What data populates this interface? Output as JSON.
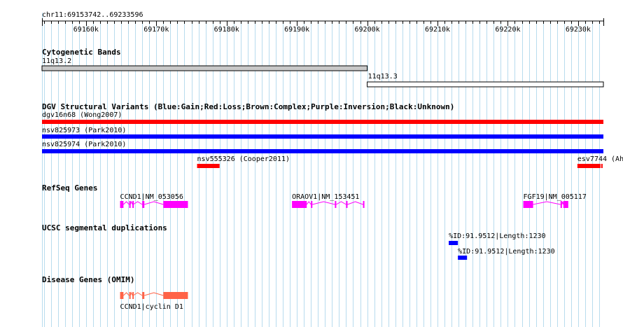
{
  "ruler": {
    "title": "chr11:69153742..69233596",
    "start": 69153742,
    "end": 69233596,
    "ticks": [
      {
        "pos": 69160000,
        "label": "69160k"
      },
      {
        "pos": 69170000,
        "label": "69170k"
      },
      {
        "pos": 69180000,
        "label": "69180k"
      },
      {
        "pos": 69190000,
        "label": "69190k"
      },
      {
        "pos": 69200000,
        "label": "69200k"
      },
      {
        "pos": 69210000,
        "label": "69210k"
      },
      {
        "pos": 69220000,
        "label": "69220k"
      },
      {
        "pos": 69230000,
        "label": "69230k"
      }
    ]
  },
  "colors": {
    "grid": "#b8dcee",
    "gain": "#0000ff",
    "loss": "#ff0000",
    "refseq": "#ff00ff",
    "omim": "#ff6347",
    "band": "#c8c8c8"
  },
  "tracks": {
    "cytoband": {
      "title": "Cytogenetic Bands",
      "features": [
        {
          "label": "11q13.2",
          "start": 69153742,
          "end": 69200000,
          "fill": "#c8c8c8"
        },
        {
          "label": "11q13.3",
          "start": 69200000,
          "end": 69233596,
          "fill": "#ffffff"
        }
      ]
    },
    "dgv": {
      "title": "DGV Structural Variants (Blue:Gain;Red:Loss;Brown:Complex;Purple:Inversion;Black:Unknown)",
      "features": [
        {
          "label": "dgv16n68 (Wong2007)",
          "start": 69153742,
          "end": 69233596,
          "type": "loss"
        },
        {
          "label": "nsv825973 (Park2010)",
          "start": 69153742,
          "end": 69233596,
          "type": "gain"
        },
        {
          "label": "nsv825974 (Park2010)",
          "start": 69153742,
          "end": 69233596,
          "type": "gain"
        },
        {
          "label": "nsv555326 (Cooper2011)",
          "start": 69175800,
          "end": 69179000,
          "type": "loss"
        },
        {
          "label": "esv7744 (Ahn",
          "start": 69229900,
          "end": 69233600,
          "type": "loss"
        }
      ]
    },
    "refseq": {
      "title": "RefSeq Genes",
      "genes": [
        {
          "label": "CCND1|NM_053056",
          "exons": [
            [
              69164850,
              69165330
            ],
            [
              69166150,
              69166300
            ],
            [
              69166600,
              69166700
            ],
            [
              69168000,
              69168300
            ],
            [
              69171000,
              69174500
            ]
          ]
        },
        {
          "label": "ORAOV1|NM_153451",
          "exons": [
            [
              69189300,
              69191400
            ],
            [
              69192000,
              69192200
            ],
            [
              69195400,
              69195600
            ],
            [
              69197000,
              69197200
            ],
            [
              69199400,
              69199600
            ]
          ]
        },
        {
          "label": "FGF19|NM_005117",
          "exons": [
            [
              69222200,
              69223600
            ],
            [
              69227500,
              69227700
            ],
            [
              69227900,
              69228600
            ]
          ]
        }
      ]
    },
    "segdup": {
      "title": "UCSC segmental duplications",
      "features": [
        {
          "label": "%ID:91.9512|Length:1230",
          "start": 69211600,
          "end": 69212900
        },
        {
          "label": "%ID:91.9512|Length:1230",
          "start": 69212900,
          "end": 69214200
        }
      ]
    },
    "omim": {
      "title": "Disease Genes (OMIM)",
      "genes": [
        {
          "label": "CCND1|cyclin D1",
          "exons": [
            [
              69164850,
              69165330
            ],
            [
              69166150,
              69166300
            ],
            [
              69166600,
              69166700
            ],
            [
              69168000,
              69168300
            ],
            [
              69171000,
              69174500
            ]
          ]
        }
      ]
    }
  }
}
